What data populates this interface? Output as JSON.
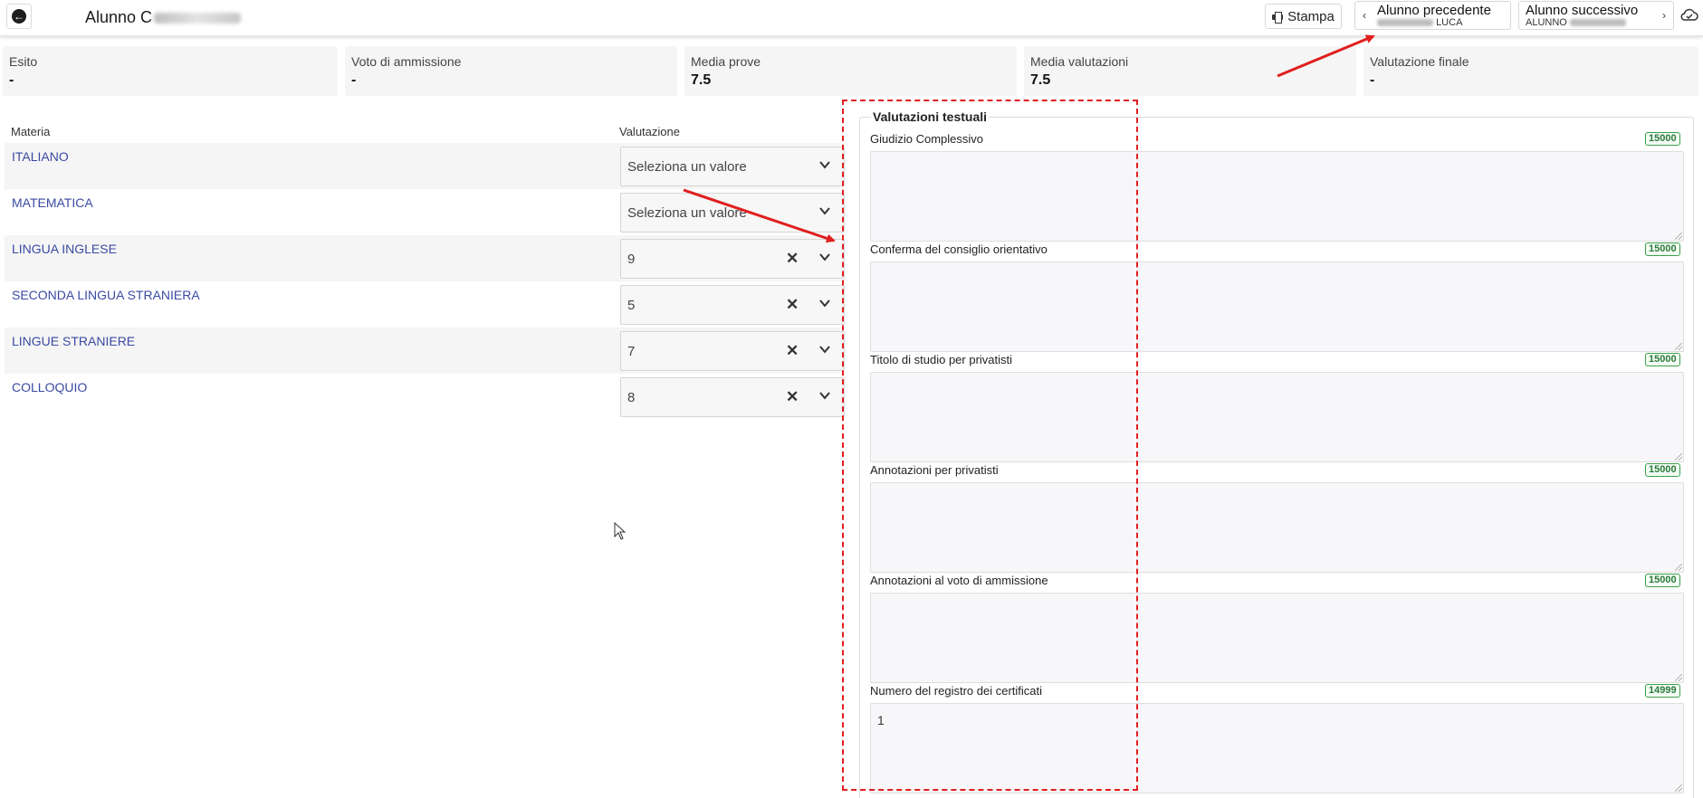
{
  "header": {
    "title": "Alunno C",
    "print_label": "Stampa",
    "prev_label": "Alunno precedente",
    "prev_sub": "LUCA",
    "next_label": "Alunno successivo",
    "next_sub": "ALUNNO"
  },
  "summary": [
    {
      "label": "Esito",
      "value": "-"
    },
    {
      "label": "Voto di ammissione",
      "value": "-"
    },
    {
      "label": "Media prove",
      "value": "7.5"
    },
    {
      "label": "Media valutazioni",
      "value": "7.5"
    },
    {
      "label": "Valutazione finale",
      "value": "-"
    }
  ],
  "grades": {
    "col_subject": "Materia",
    "col_grade": "Valutazione",
    "placeholder": "Seleziona un valore",
    "rows": [
      {
        "subject": "ITALIANO",
        "value": "Seleziona un valore"
      },
      {
        "subject": "MATEMATICA",
        "value": "Seleziona un valore"
      },
      {
        "subject": "LINGUA INGLESE",
        "value": "9"
      },
      {
        "subject": "SECONDA LINGUA STRANIERA",
        "value": "5"
      },
      {
        "subject": "LINGUE STRANIERE",
        "value": "7"
      },
      {
        "subject": "COLLOQUIO",
        "value": "8"
      }
    ]
  },
  "text_evals": {
    "legend": "Valutazioni testuali",
    "fields": [
      {
        "label": "Giudizio Complessivo",
        "count": "15000",
        "value": ""
      },
      {
        "label": "Conferma del consiglio orientativo",
        "count": "15000",
        "value": ""
      },
      {
        "label": "Titolo di studio per privatisti",
        "count": "15000",
        "value": ""
      },
      {
        "label": "Annotazioni per privatisti",
        "count": "15000",
        "value": ""
      },
      {
        "label": "Annotazioni al voto di ammissione",
        "count": "15000",
        "value": ""
      },
      {
        "label": "Numero del registro dei certificati",
        "count": "14999",
        "value": "1"
      }
    ]
  },
  "colors": {
    "accent_link": "#3a4aa3",
    "counter_green": "#3aa14a",
    "annotation_red": "#e01f1f"
  },
  "icons": [
    "back-icon",
    "print-icon",
    "chevron-left-icon",
    "chevron-right-icon",
    "cloud-icon",
    "clear-icon",
    "chevron-down-icon"
  ]
}
